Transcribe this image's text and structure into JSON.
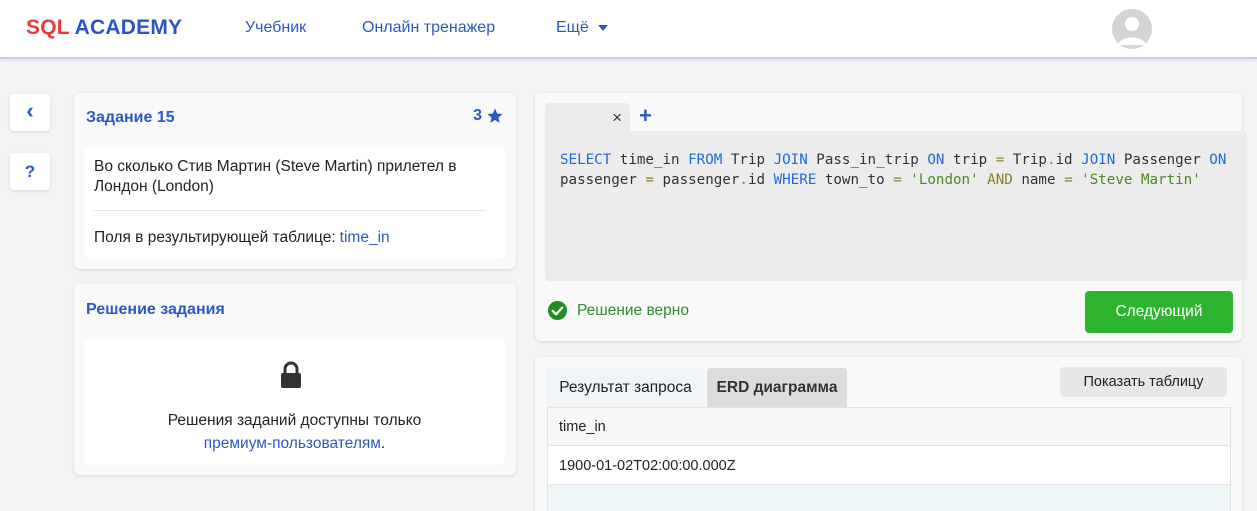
{
  "header": {
    "logo_sql": "SQL",
    "logo_academy": "ACADEMY",
    "nav": {
      "tutorial": "Учебник",
      "trainer": "Онлайн тренажер",
      "more": "Ещё"
    },
    "avatar_icon": "user-avatar-icon"
  },
  "side": {
    "back": "‹",
    "help": "?"
  },
  "task": {
    "title": "Задание 15",
    "difficulty": "3",
    "description": "Во сколько Стив Мартин (Steve Martin) прилетел в Лондон (London)",
    "fields_label": "Поля в результирующей таблице:",
    "fields_value": "time_in"
  },
  "solution": {
    "title": "Решение задания",
    "locked_text": "Решения заданий доступны только",
    "premium_link": "премиум-пользователям",
    "period": "."
  },
  "editor": {
    "tab_close": "×",
    "tab_add": "+",
    "code": {
      "t1": "SELECT",
      "t2": "time_in",
      "t3": "FROM",
      "t4": "Trip",
      "t5": "JOIN",
      "t6": "Pass_in_trip",
      "t7": "ON",
      "t8": "trip",
      "t9": "=",
      "t10": "Trip",
      "t11": ".",
      "t12": "id",
      "t13": "JOIN",
      "t14": "Passenger",
      "t15": "ON",
      "t16": "passenger",
      "t17": "=",
      "t18": "passenger",
      "t19": ".",
      "t20": "id",
      "t21": "WHERE",
      "t22": "town_to",
      "t23": "=",
      "t24": "'London'",
      "t25": "AND",
      "t26": "name",
      "t27": "=",
      "t28": "'Steve Martin'"
    },
    "status": "Решение верно",
    "next_button": "Следующий"
  },
  "results": {
    "tab_result": "Результат запроса",
    "tab_erd": "ERD диаграмма",
    "show_table": "Показать таблицу",
    "columns": [
      "time_in"
    ],
    "rows": [
      [
        "1900-01-02T02:00:00.000Z"
      ]
    ]
  },
  "colors": {
    "accent": "#2b59c3",
    "logo_red": "#e83a3a",
    "success": "#2fb42f",
    "success_text": "#2e8b2e"
  }
}
